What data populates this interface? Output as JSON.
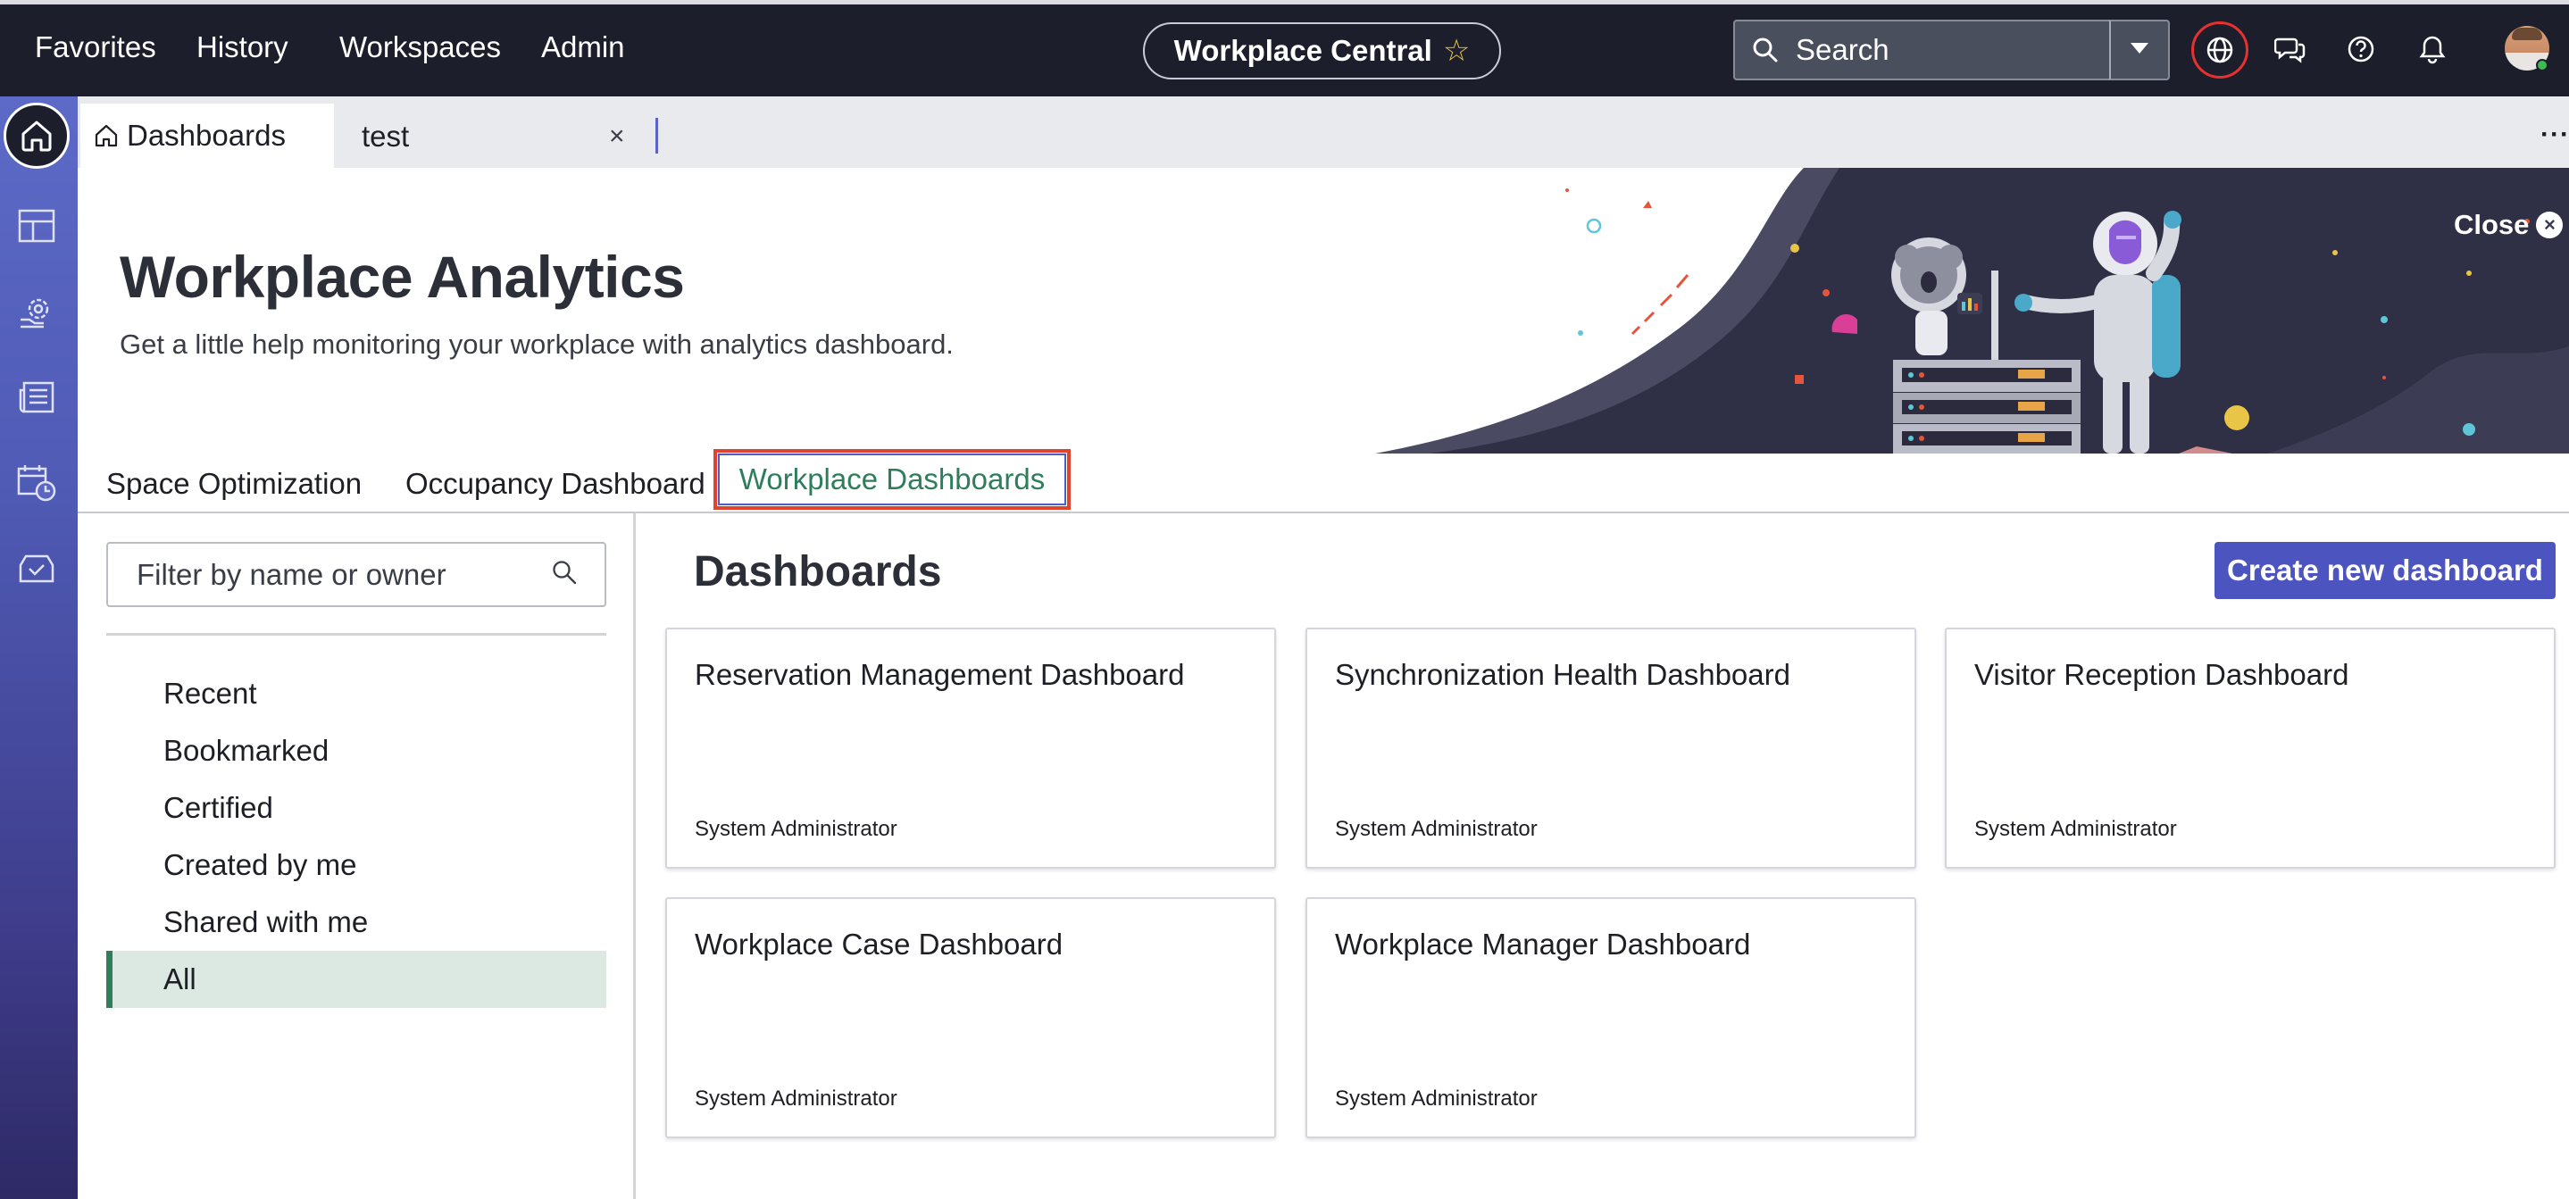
{
  "topbar": {
    "nav": [
      "Favorites",
      "History",
      "Workspaces",
      "Admin"
    ],
    "app_name": "Workplace Central",
    "star_icon": "star-outline-icon",
    "search_placeholder": "Search",
    "icons": [
      "globe-icon",
      "chat-icon",
      "help-icon",
      "bell-icon"
    ]
  },
  "rail": {
    "icons": [
      "home-icon",
      "layout-icon",
      "settings-gear-icon",
      "newspaper-icon",
      "calendar-clock-icon",
      "inbox-check-icon"
    ]
  },
  "tabs": {
    "active_label": "Dashboards",
    "second_label": "test",
    "close_glyph": "×",
    "more_glyph": "···"
  },
  "banner": {
    "title": "Workplace Analytics",
    "subtitle": "Get a little help monitoring your workplace with analytics dashboard.",
    "close_label": "Close",
    "close_glyph": "×"
  },
  "subtabs": [
    {
      "label": "Space Optimization"
    },
    {
      "label": "Occupancy Dashboard"
    },
    {
      "label": "Workplace Dashboards"
    }
  ],
  "filter": {
    "placeholder": "Filter by name or owner",
    "items": [
      "Recent",
      "Bookmarked",
      "Certified",
      "Created by me",
      "Shared with me",
      "All"
    ],
    "selected": "All"
  },
  "main": {
    "title": "Dashboards",
    "create_label": "Create new dashboard",
    "cards": [
      {
        "title": "Reservation Management Dashboard",
        "owner": "System Administrator"
      },
      {
        "title": "Synchronization Health Dashboard",
        "owner": "System Administrator"
      },
      {
        "title": "Visitor Reception Dashboard",
        "owner": "System Administrator"
      },
      {
        "title": "Workplace Case Dashboard",
        "owner": "System Administrator"
      },
      {
        "title": "Workplace Manager Dashboard",
        "owner": "System Administrator"
      }
    ]
  },
  "colors": {
    "topbar_bg": "#1c1f2b",
    "accent": "#4c54c0",
    "selected_green": "#2e7d5b",
    "highlight_red": "#e0442f"
  }
}
